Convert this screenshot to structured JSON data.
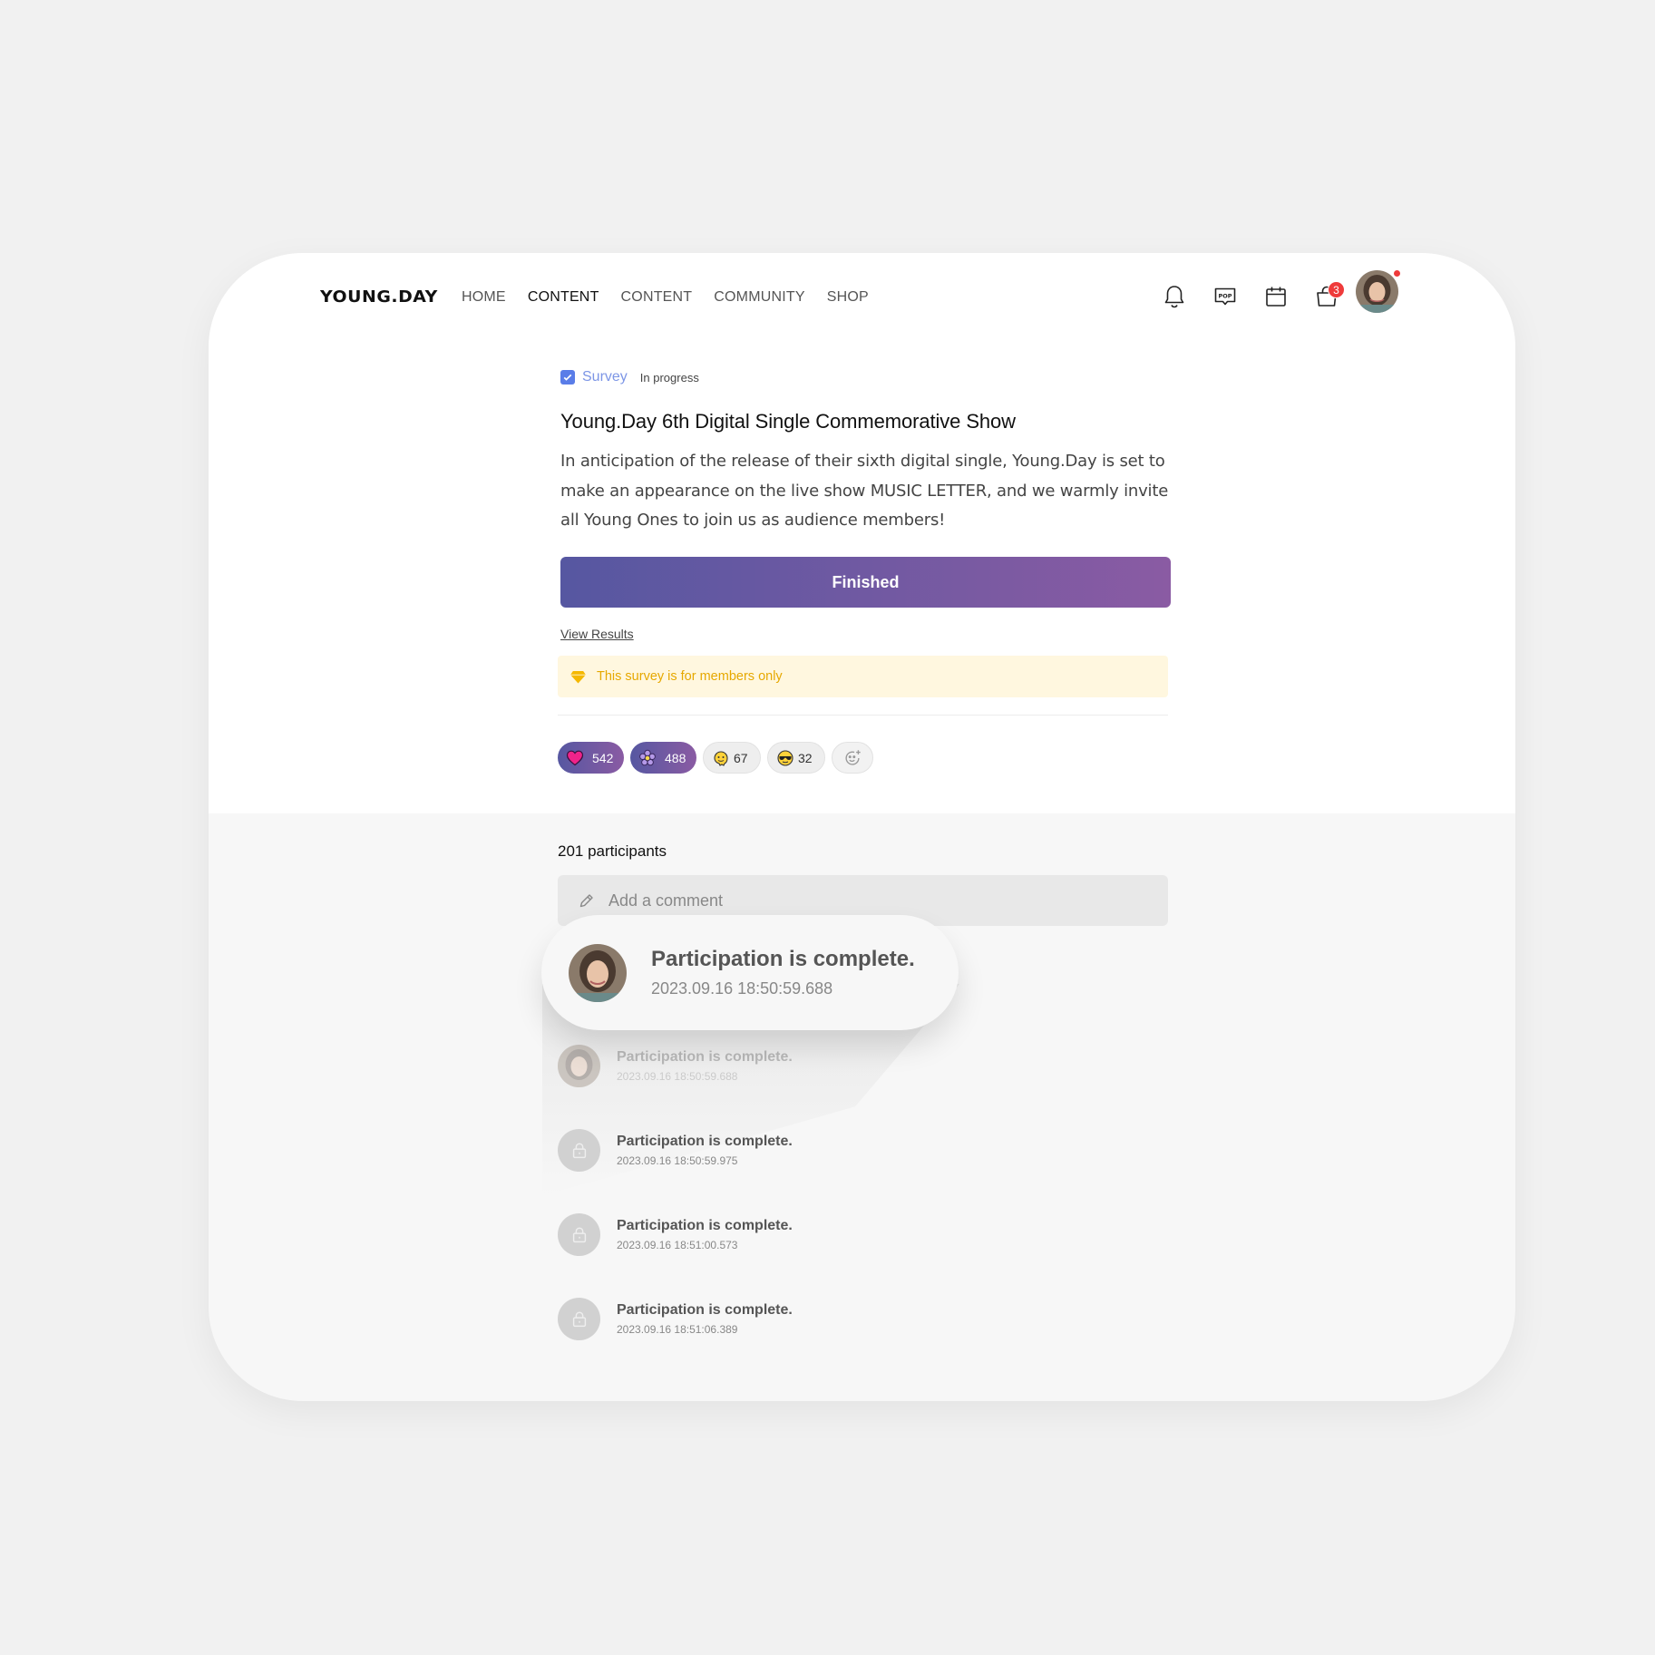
{
  "header": {
    "logo": "YOUNG.DAY",
    "nav": [
      "HOME",
      "CONTENT",
      "CONTENT",
      "COMMUNITY",
      "SHOP"
    ],
    "active_index": 1,
    "icons": [
      "bell-icon",
      "pop-chat-icon",
      "calendar-icon",
      "shopping-bag-icon"
    ],
    "pop_label": "POP",
    "cart_count": "3"
  },
  "post": {
    "type": "Survey",
    "status": "In progress",
    "title": "Young.Day 6th Digital Single Commemorative Show",
    "description": "In anticipation of the release of their sixth digital single, Young.Day is set to make an appearance on the live show MUSIC LETTER, and we warmly invite all Young Ones to join us as audience members!",
    "button_label": "Finished",
    "view_results": "View Results",
    "notice": "This survey is for members only",
    "accent_gradient": [
      "#5657a1",
      "#8a5ba3"
    ]
  },
  "reactions": [
    {
      "icon": "heart-icon",
      "count": "542",
      "style": "gradient"
    },
    {
      "icon": "flower-icon",
      "count": "488",
      "style": "gradient"
    },
    {
      "icon": "melting-face-icon",
      "count": "67",
      "style": "light"
    },
    {
      "icon": "sunglasses-face-icon",
      "count": "32",
      "style": "light"
    },
    {
      "icon": "add-reaction-icon",
      "count": "",
      "style": "add"
    }
  ],
  "comments": {
    "participants": "201 participants",
    "placeholder": "Add a comment",
    "highlight": {
      "text": "Participation is complete.",
      "time": "2023.09.16 18:50:59.688"
    },
    "items": [
      {
        "text": "Participation is complete.",
        "time": "2023.09.16 18:50:59.688",
        "avatar": "photo"
      },
      {
        "text": "Participation is complete.",
        "time": "2023.09.16 18:50:59.975",
        "avatar": "locked"
      },
      {
        "text": "Participation is complete.",
        "time": "2023.09.16 18:51:00.573",
        "avatar": "locked"
      },
      {
        "text": "Participation is complete.",
        "time": "2023.09.16 18:51:06.389",
        "avatar": "locked"
      }
    ]
  }
}
